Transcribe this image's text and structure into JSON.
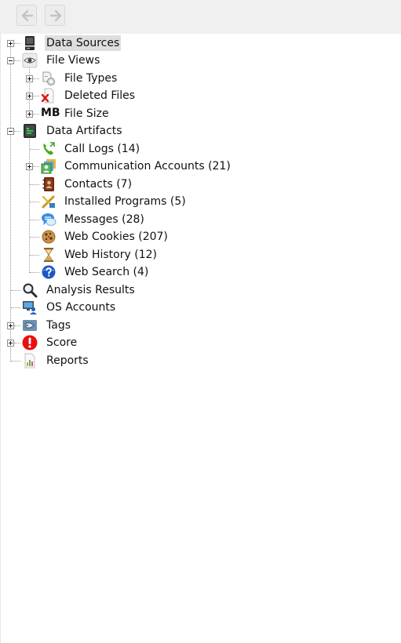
{
  "toolbar": {
    "back_button": {
      "icon": "arrow-left-icon",
      "enabled": false
    },
    "forward_button": {
      "icon": "arrow-right-icon",
      "enabled": false
    }
  },
  "tree": {
    "data_sources": "Data Sources",
    "file_views": "File Views",
    "file_types": "File Types",
    "deleted_files": "Deleted Files",
    "file_size": "File Size",
    "file_size_icon_text": "MB",
    "data_artifacts": "Data Artifacts",
    "call_logs": "Call Logs (14)",
    "communication_accounts": "Communication Accounts (21)",
    "contacts": "Contacts (7)",
    "installed_programs": "Installed Programs (5)",
    "messages": "Messages (28)",
    "web_cookies": "Web Cookies (207)",
    "web_history": "Web History (12)",
    "web_search": "Web Search (4)",
    "analysis_results": "Analysis Results",
    "os_accounts": "OS Accounts",
    "tags": "Tags",
    "score": "Score",
    "reports": "Reports"
  },
  "selected_item": "Data Sources",
  "colors": {
    "selection_bg": "#dedede",
    "toolbar_bg": "#f0f0f0",
    "score_red": "#e81010"
  }
}
